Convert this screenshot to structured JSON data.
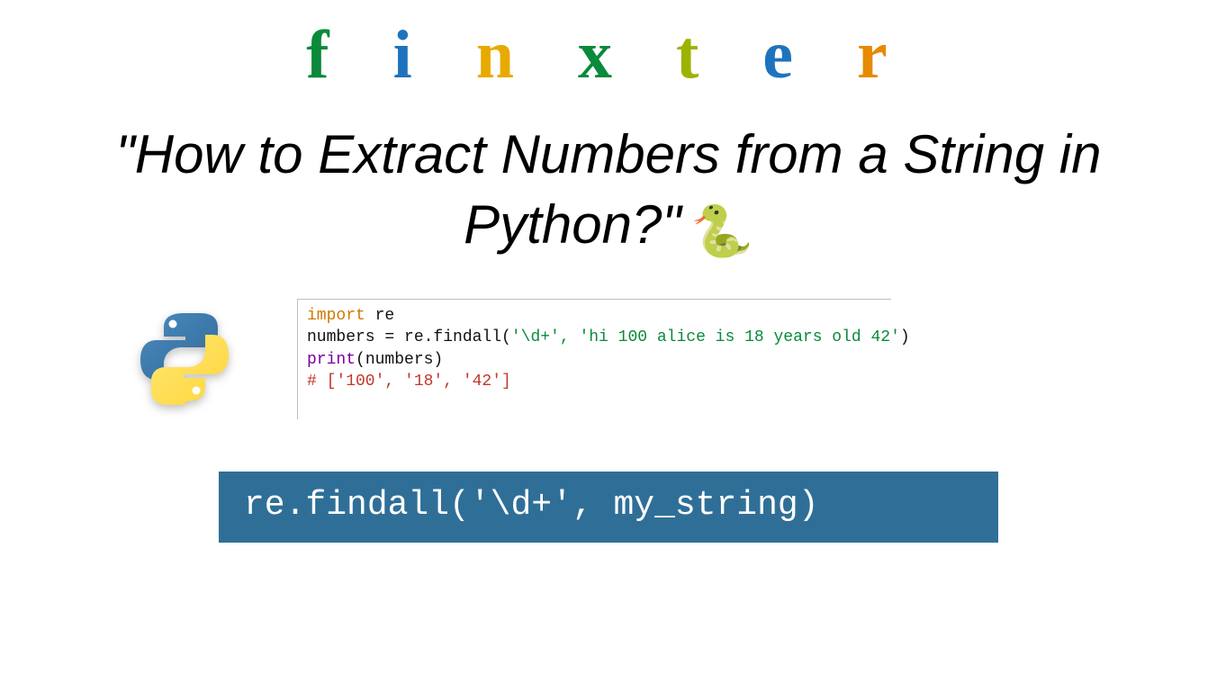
{
  "brand": {
    "letters": [
      {
        "char": "f",
        "color": "#0a8a3a"
      },
      {
        "char": "i",
        "color": "#1e73be"
      },
      {
        "char": "n",
        "color": "#e8aa00"
      },
      {
        "char": "x",
        "color": "#0a8a3a"
      },
      {
        "char": "t",
        "color": "#9db300"
      },
      {
        "char": "e",
        "color": "#1e73be"
      },
      {
        "char": "r",
        "color": "#e78a00"
      }
    ]
  },
  "title": {
    "text": "\"How to Extract Numbers from a String in Python?\"",
    "emoji": "🐍"
  },
  "code": {
    "line1_kw": "import",
    "line1_mod": " re",
    "line2_a": "numbers = re.findall(",
    "line2_str": "'\\d+', 'hi 100 alice is 18 years old 42'",
    "line2_b": ")",
    "line3_fn": "print",
    "line3_args": "(numbers)",
    "line4_comment": "# ['100', '18', '42']"
  },
  "banner": {
    "text": "re.findall('\\d+', my_string)"
  },
  "colors": {
    "banner_bg": "#2f6f97",
    "banner_fg": "#ffffff"
  }
}
